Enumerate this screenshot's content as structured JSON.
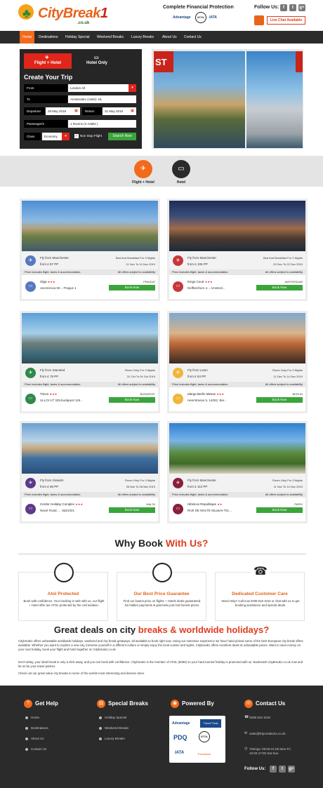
{
  "header": {
    "logo_text": "CityBreak",
    "logo_number": "1",
    "logo_sub": ".co.uk",
    "protection_title": "Complete Financial Protection",
    "badges": {
      "advantage": "Advantage",
      "atol": "ATOL",
      "iata": "IATA"
    },
    "follow_label": "Follow Us:",
    "social": [
      "f",
      "t",
      "g+"
    ],
    "live_chat": "Live Chat Available"
  },
  "nav": [
    "Home",
    "Destinations",
    "Holiday Special",
    "Weekend Breaks",
    "Luxury Breaks",
    "About Us",
    "Contact Us"
  ],
  "search": {
    "tab_flight_hotel": "Flight + Hotel",
    "tab_hotel_only": "Hotel Only",
    "title": "Create Your Trip",
    "from_label": "From",
    "from_value": "London All",
    "to_label": "To",
    "to_value": "Amsterdam (AMS): NL",
    "departure_label": "Departure",
    "departure_value": "28 May 2018",
    "return_label": "Return",
    "return_value": "31 May 2018",
    "passengers_label": "Passenger/s",
    "passengers_value": "1 Rooms (2 Adults )",
    "class_label": "Class",
    "class_value": "Economy",
    "nonstop_label": "Non Stop Flight",
    "search_button": "Search Now"
  },
  "hero_sign": "ST",
  "toggle": {
    "flight_hotel": "Flight + Hotel",
    "hotel": "Hotel"
  },
  "deals": [
    {
      "from": "Fly from Manchester",
      "price": "from £ 87 PP",
      "right1": "Bed And Breakfast For 3 Nights",
      "right2": "11 Nov To 14 Nov 2019",
      "strip_left": "Price includes flight, taxes & accommodation.",
      "strip_right": "All offers subject to availability",
      "hotel": "Olga",
      "stars": "★★★",
      "addr": "Jaromirova 50... Prague 1",
      "city": "PRAGUE",
      "book": "Book Now"
    },
    {
      "from": "Fly from Manchester",
      "price": "from £ 106 PP",
      "right1": "Bed And Breakfast For 2 Nights",
      "right2": "20 Dec To 22 Dec 2019",
      "strip_left": "Price includes flight, taxes & accommodation.",
      "strip_right": "All offers subject to availability",
      "hotel": "Kings Court",
      "stars": "★★★",
      "addr": "Delfbenhurn 4... Amsterd...",
      "city": "AMSTERDAM",
      "book": "Book Now"
    },
    {
      "from": "Fly from Stansted",
      "price": "from £ 78 PP",
      "right1": "Room Only For 3 Nights",
      "right2": "31 Oct To 04 Oct 2019",
      "strip_left": "Price includes flight, taxes & accommodation.",
      "strip_right": "All offers subject to availability",
      "hotel": "Timon",
      "stars": "★★★",
      "addr": "ULLOI UT 329,budapest 119...",
      "city": "BUDAPEST",
      "book": "Book Now"
    },
    {
      "from": "Fly from Luton",
      "price": "from £ 84 PP",
      "right1": "Room Only For 3 Nights",
      "right2": "11 Dec To 14 Dec 2019",
      "strip_left": "Price includes flight, taxes & accommodation.",
      "strip_right": "All offers subject to availability",
      "hotel": "Iderga Berlin Messe",
      "stars": "★★★",
      "addr": "Heerstrasse 5, 14052, Ber...",
      "city": "BERLIN",
      "book": "Book Now"
    },
    {
      "from": "Fly from Gatwick",
      "price": "from £ 86 PP",
      "right1": "Room Only For 3 Nights",
      "right2": "05 Mar To 08 Mar 2019",
      "strip_left": "Price includes flight, taxes & accommodation.",
      "strip_right": "All offers subject to availability",
      "hotel": "Cerdor Holiday Complex",
      "stars": "★★★",
      "addr": "Naxxt Road, ... Spb1021",
      "city": "MALTA",
      "book": "Book Now"
    },
    {
      "from": "Fly from Manchester",
      "price": "from £ 112 PP",
      "right1": "Room Only For 3 Nights",
      "right2": "11 Nov To 14 Nov 2019",
      "strip_left": "Price includes flight, taxes & accommodation.",
      "strip_right": "All offers subject to availability",
      "hotel": "Hibiscus Republique",
      "stars": "★★",
      "addr": "RUE DE MALTE 58,paris-751...",
      "city": "PARIS",
      "book": "Book Now"
    }
  ],
  "why": {
    "title_a": "Why Book ",
    "title_b": "With Us?",
    "boxes": [
      {
        "title": "Atol Protected",
        "text": "Book with confidence. Your booking is safe with us, our flight + Hotel offer are ATOL protected by the civil aviation."
      },
      {
        "title": "Our Best Price Guarantee",
        "text": "Find our lowest price on flights + Hotels deals guaranteed. No hidden payments & gimmicks just real honest prices."
      },
      {
        "title": "Dedicated Customer Care",
        "text": "Need Help? Call now 0208 518 1010 or chat with us to get booking assistance and special deals."
      }
    ]
  },
  "great": {
    "title_a": "Great deals on city ",
    "title_b": "breaks & worldwide holidays?",
    "p1": "Citybreak1 offers unbeatable worldwide holidays, weekend and city break getaways, all available to book right now. Using our extensive experience we have hand picked some of the best European city break offers available. Whether you want to explore a new city, immerse yourself in a different culture or simply enjoy the local cuisine and sights, Citybreak1 offers excellent deals at unbeatable prices. Want to save money on your next holiday, book your flight and hotel together on Citybreak1.co.uk",
    "p2": "Don't delay, your ideal break is only a click away, and you can book with confidence. Citybreak1 is the member of ATOL (5080) so your hard earned holiday is protected with us. Bookmark CityBreak1.co.uk now and let us be your travel partner.",
    "p3": "Check out our great value city breaks to some of the worlds most interesting and diverse cities."
  },
  "footer": {
    "help_title": "Get Help",
    "help_links": [
      "Home",
      "Destinations",
      "About Us",
      "Contact Us"
    ],
    "special_title": "Special Breaks",
    "special_links": [
      "Holiday Special",
      "Weekend Breaks",
      "Luxury Breaks"
    ],
    "powered_title": "Powered By",
    "powered_logos": [
      "Advantage",
      "Travel Trust",
      "PDQ",
      "ATOL",
      "IATA",
      "Travelpack"
    ],
    "contact_title": "Contact Us",
    "phone": "0208 518 1010",
    "email": "sales@tripcreations.co.uk",
    "timings": "Timings: 09:00-21:00 Mon-Fri 10:00-17:00 Sat-Sun",
    "follow": "Follow Us:",
    "social": [
      "f",
      "t",
      "g+"
    ]
  }
}
